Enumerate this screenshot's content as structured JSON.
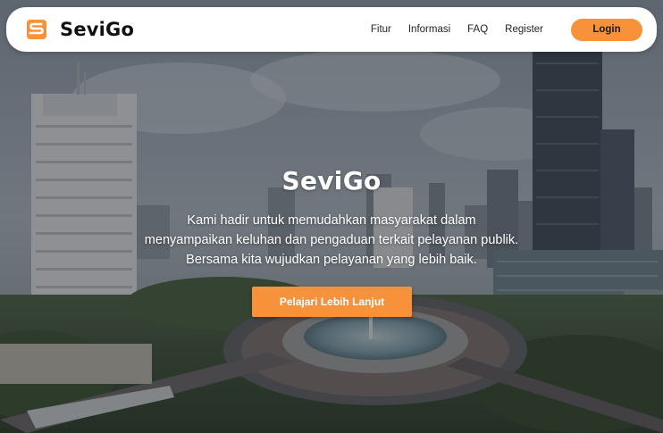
{
  "navbar": {
    "brand_name": "SeviGo",
    "links": [
      {
        "label": "Fitur"
      },
      {
        "label": "Informasi"
      },
      {
        "label": "FAQ"
      },
      {
        "label": "Register"
      }
    ],
    "login_label": "Login"
  },
  "hero": {
    "title": "SeviGo",
    "description": "Kami hadir untuk memudahkan masyarakat dalam menyampaikan keluhan dan pengaduan terkait pelayanan publik. Bersama kita wujudkan pelayanan yang lebih baik.",
    "cta_label": "Pelajari Lebih Lanjut"
  },
  "colors": {
    "accent": "#f7923a",
    "navbar_bg": "#ffffff",
    "text_dark": "#111111",
    "hero_text": "#ffffff"
  },
  "icons": {
    "logo": "sevigo-logo-icon"
  }
}
